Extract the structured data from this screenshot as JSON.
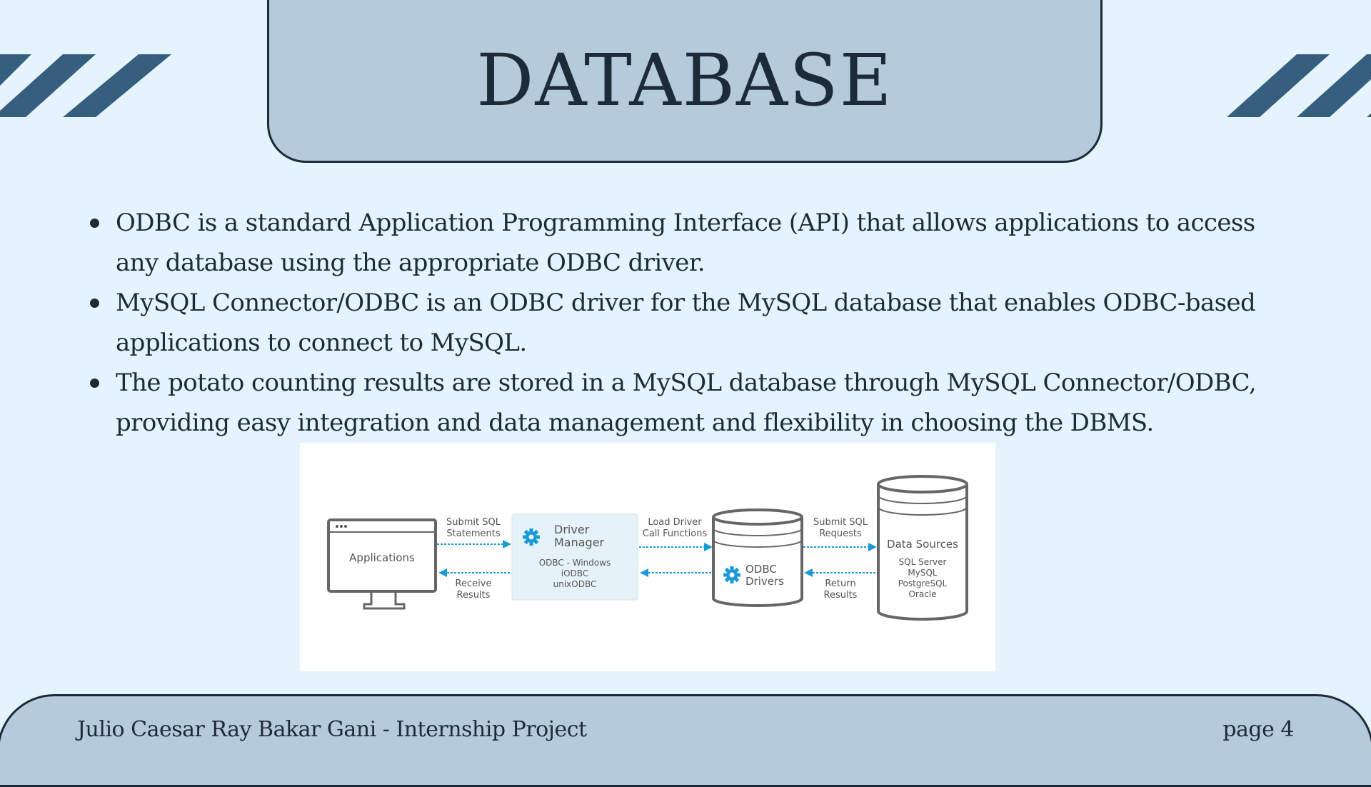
{
  "slide": {
    "title": "DATABASE",
    "bullets": [
      "ODBC is a standard Application Programming Interface (API) that allows applications to access any database using the appropriate ODBC driver.",
      "MySQL Connector/ODBC is an ODBC driver for the MySQL database that enables ODBC-based applications to connect to MySQL.",
      "The potato counting results are stored in a MySQL database through MySQL Connector/ODBC, providing easy integration and data management and flexibility in choosing the DBMS."
    ],
    "footer_left": "Julio Caesar Ray Bakar Gani - Internship Project",
    "footer_right": "page 4"
  },
  "diagram": {
    "applications": "Applications",
    "submit_sql_statements": [
      "Submit SQL",
      "Statements"
    ],
    "receive_results": [
      "Receive",
      "Results"
    ],
    "driver_manager_title": [
      "Driver",
      "Manager"
    ],
    "driver_manager_items": [
      "ODBC  - Windows",
      "iODBC",
      "unixODBC"
    ],
    "load_driver": [
      "Load Driver",
      "Call Functions"
    ],
    "odbc_drivers": [
      "ODBC",
      "Drivers"
    ],
    "submit_sql_requests": [
      "Submit SQL",
      "Requests"
    ],
    "return_results": [
      "Return",
      "Results"
    ],
    "data_sources_title": "Data Sources",
    "data_sources_items": [
      "SQL Server",
      "MySQL",
      "PostgreSQL",
      "Oracle"
    ]
  },
  "colors": {
    "background": "#e5f4fc",
    "panel": "#b5cadb",
    "dark": "#1c2b3a",
    "stripe": "#365e7e",
    "arrow": "#1a9ad6"
  },
  "icons": [
    "gear-icon",
    "monitor-icon",
    "cylinder-icon"
  ]
}
